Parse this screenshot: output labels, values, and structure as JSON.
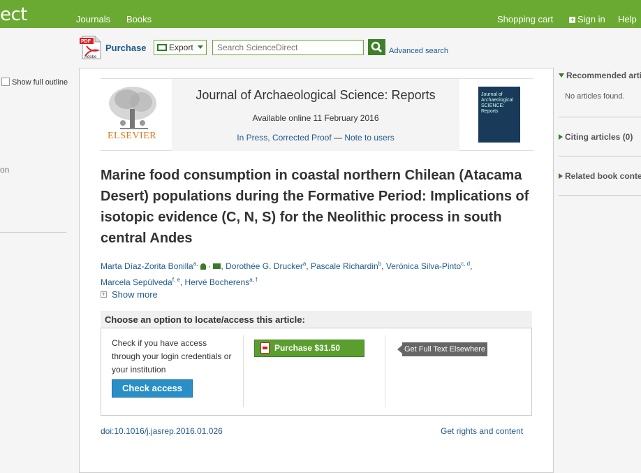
{
  "topbar": {
    "brand_fragment": "ect",
    "nav": [
      "Journals",
      "Books"
    ],
    "shopping_cart": "Shopping cart",
    "sign_in": "Sign in",
    "help": "Help",
    "accent_color": "#6aaa32"
  },
  "toolbar": {
    "pdf_icon_label": "PDF Adobe",
    "purchase_label": "Purchase",
    "export_label": "Export",
    "search_placeholder": "Search ScienceDirect",
    "advanced_search": "Advanced search"
  },
  "left_sidebar": {
    "show_full_outline": "Show full outline",
    "partial_text": "on"
  },
  "header": {
    "publisher": "ELSEVIER",
    "journal_title": "Journal of Archaeological Science: Reports",
    "available_online": "Available online 11 February 2016",
    "in_press": "In Press, Corrected Proof",
    "dash": "—",
    "note_to_users": "Note to users",
    "cover_text": "Journal of Archaeological SCIENCE: Reports"
  },
  "article": {
    "title": "Marine food consumption in coastal northern Chilean (Atacama Desert) populations during the Formative Period: Implications of isotopic evidence (C, N, S) for the Neolithic process in south central Andes",
    "authors": [
      {
        "name": "Marta Díaz-Zorita Bonilla",
        "sup": "a,"
      },
      {
        "name": "Dorothée G. Drucker",
        "sup": "a"
      },
      {
        "name": "Pascale Richardin",
        "sup": "b"
      },
      {
        "name": "Verónica Silva-Pinto",
        "sup": "c, d"
      },
      {
        "name": "Marcela Sepúlveda",
        "sup": "f, e"
      },
      {
        "name": "Hervé Bocherens",
        "sup": "a, f"
      }
    ],
    "show_more": "Show more",
    "doi": "doi:10.1016/j.jasrep.2016.01.026",
    "rights": "Get rights and content"
  },
  "access": {
    "heading": "Choose an option to locate/access this article:",
    "text": "Check if you have access through your login credentials or your institution",
    "check_access": "Check access",
    "purchase": "Purchase $31.50",
    "full_text_elsewhere": "Get Full Text Elsewhere"
  },
  "right_sidebar": {
    "recommended": "Recommended artic",
    "no_articles": "No articles found.",
    "citing": "Citing articles (0)",
    "related": "Related book conte"
  }
}
